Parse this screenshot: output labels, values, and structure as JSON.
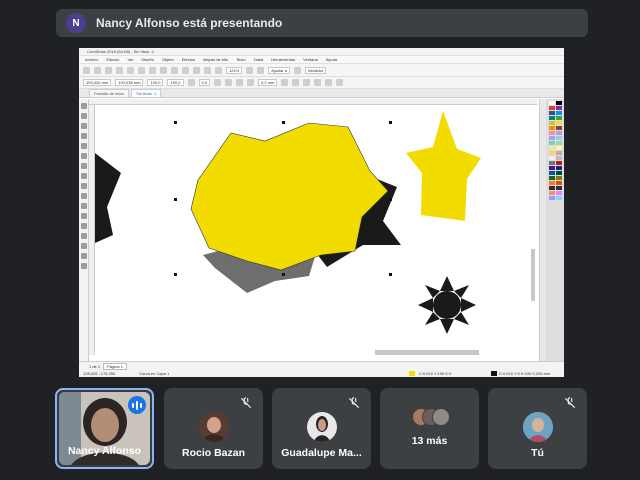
{
  "banner": {
    "avatar_letter": "N",
    "text": "Nancy Alfonso está presentando"
  },
  "screen": {
    "window_title": "CorelDraw 2018 (64-Bit) - Sin título -1",
    "menu": [
      "Archivo",
      "Edición",
      "Ver",
      "Diseño",
      "Objeto",
      "Efectos",
      "Mapas de bits",
      "Texto",
      "Tabla",
      "Herramientas",
      "Ventana",
      "Ayuda"
    ],
    "zoom": "121%",
    "snap_label": "Ajustar a",
    "launch_label": "Iniciador",
    "size_w": "153,426 mm",
    "size_h": "104,038 mm",
    "scale_x": "100,0",
    "scale_y": "100,0",
    "rotation": "0,0",
    "outline_width": "0,2 mm",
    "tabs": [
      "Pantalla de inicio",
      "Sin título -1"
    ],
    "page_nav": "1 de 1",
    "page_label": "Página 1",
    "status_coords": "128,026 ; 176,250",
    "status_layer": "Curva en Capa 1",
    "status_fill": "C:0 M:0 Y:100 K:0",
    "status_outline": "C:0 M:0 Y:0 K:100  0,200 mm",
    "shapes": {
      "yellow": "#f2dc00",
      "black": "#1a1a1a",
      "gray": "#6e6e6e"
    },
    "palette": [
      "#ffffff",
      "#000000",
      "#e53935",
      "#8e24aa",
      "#3949ab",
      "#039be5",
      "#00897b",
      "#43a047",
      "#c0ca33",
      "#fdd835",
      "#fb8c00",
      "#6d4c41",
      "#f48fb1",
      "#ce93d8",
      "#9fa8da",
      "#81d4fa",
      "#80cbc4",
      "#a5d6a7",
      "#e6ee9c",
      "#fff59d",
      "#ffcc80",
      "#bcaaa4",
      "#eeeeee",
      "#bdbdbd",
      "#757575",
      "#b71c1c",
      "#4a148c",
      "#1a237e",
      "#01579b",
      "#004d40",
      "#1b5e20",
      "#827717",
      "#f57f17",
      "#e65100",
      "#3e2723",
      "#263238",
      "#ff8a80",
      "#ea80fc",
      "#8c9eff",
      "#80d8ff"
    ]
  },
  "participants": [
    {
      "name": "Nancy Alfonso",
      "presenter": true
    },
    {
      "name": "Rocio Bazan",
      "muted": true,
      "avatar_color": "#5a3b32"
    },
    {
      "name": "Guadalupe Ma...",
      "muted": true,
      "avatar_color": "#3a3533"
    },
    {
      "name": "13 más",
      "muted": false
    },
    {
      "name": "Tú",
      "muted": true,
      "avatar_color": "#7c8da3"
    }
  ]
}
